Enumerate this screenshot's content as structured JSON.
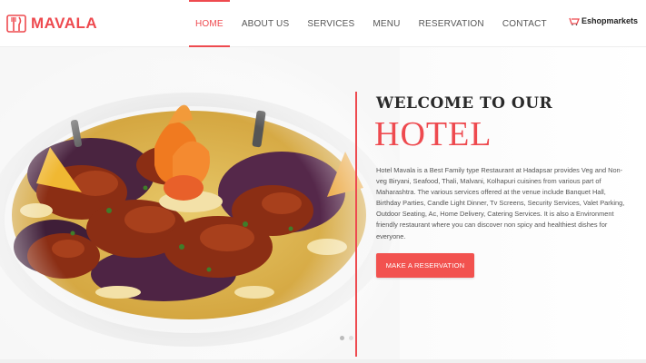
{
  "brand": {
    "name": "MAVALA",
    "accent_color": "#ee4a4f",
    "logo_icon": "fork-knife-logo-icon"
  },
  "nav": {
    "items": [
      {
        "label": "HOME",
        "active": true
      },
      {
        "label": "ABOUT US",
        "active": false
      },
      {
        "label": "SERVICES",
        "active": false
      },
      {
        "label": "MENU",
        "active": false
      },
      {
        "label": "RESERVATION",
        "active": false
      },
      {
        "label": "CONTACT",
        "active": false
      }
    ]
  },
  "partner": {
    "label": "Eshopmarkets",
    "icon": "eshop-logo-icon"
  },
  "hero": {
    "image": "biryani-dish-image",
    "heading_line1": "WELCOME TO OUR",
    "heading_line2": "HOTEL",
    "description": "Hotel Mavala is a Best Family type Restaurant at Hadapsar provides Veg and Non-veg Biryani, Seafood, Thali, Malvani, Kolhapuri cuisines from various part of Maharashtra. The various services offered at the venue include Banquet Hall, Birthday Parties, Candle Light Dinner, Tv Screens, Security Services, Valet Parking, Outdoor Seating, Ac, Home Delivery, Catering Services. It is also a Environment friendly restaurant where you can discover non spicy and healthiest dishes for everyone.",
    "cta_label": "MAKE A RESERVATION",
    "cta_color": "#f2524f"
  }
}
